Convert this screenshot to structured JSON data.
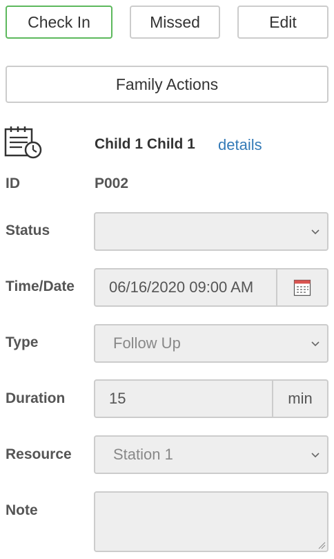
{
  "actions": {
    "check_in": "Check In",
    "missed": "Missed",
    "edit": "Edit",
    "family_actions": "Family Actions"
  },
  "patient": {
    "name": "Child 1 Child 1",
    "details_link": "details",
    "id_label": "ID",
    "id_value": "P002"
  },
  "form": {
    "status": {
      "label": "Status",
      "value": ""
    },
    "time_date": {
      "label": "Time/Date",
      "value": "06/16/2020 09:00 AM"
    },
    "type": {
      "label": "Type",
      "value": "Follow Up"
    },
    "duration": {
      "label": "Duration",
      "value": "15",
      "unit": "min"
    },
    "resource": {
      "label": "Resource",
      "value": "Station 1"
    },
    "note": {
      "label": "Note",
      "value": ""
    }
  },
  "colors": {
    "check_in_border": "#5cb85c",
    "link": "#337ab7",
    "calendar_icon": "#d9534f"
  }
}
